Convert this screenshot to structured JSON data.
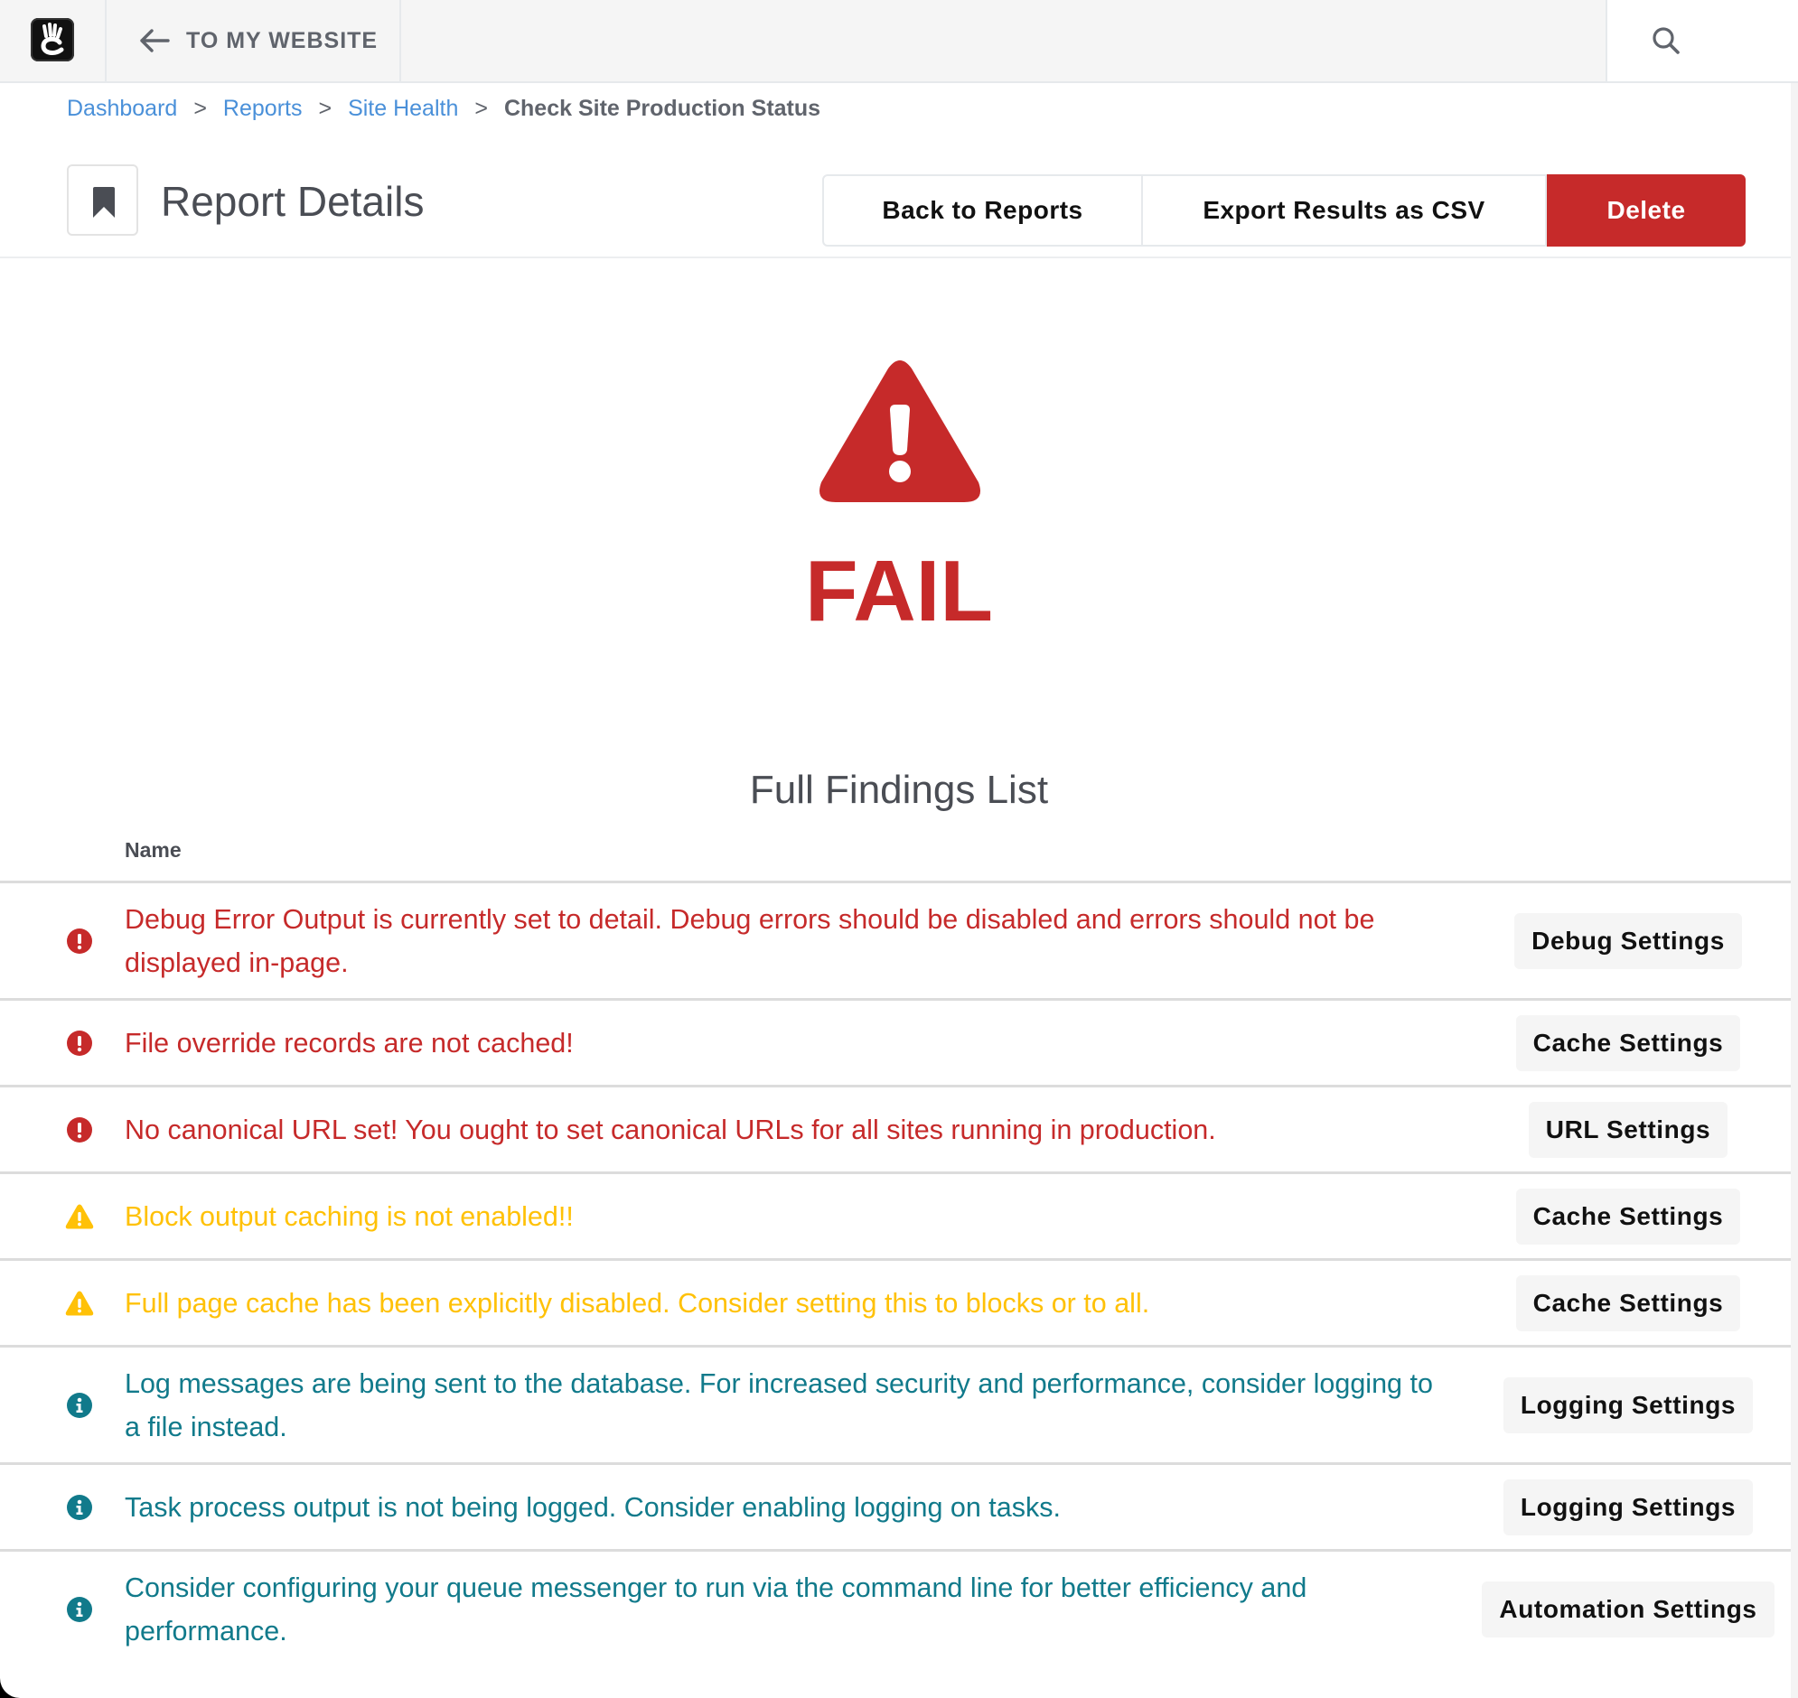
{
  "topbar": {
    "logo_icon": "concrete-hand-logo",
    "back_icon": "arrow-left-icon",
    "back_label": "TO MY WEBSITE",
    "search_icon": "search-icon"
  },
  "breadcrumb": [
    {
      "label": "Dashboard"
    },
    {
      "label": "Reports"
    },
    {
      "label": "Site Health"
    },
    {
      "label": "Check Site Production Status"
    }
  ],
  "breadcrumb_separator": ">",
  "header": {
    "title_icon": "bookmark-icon",
    "title": "Report Details",
    "buttons": {
      "back": "Back to Reports",
      "export": "Export Results as CSV",
      "delete": "Delete"
    }
  },
  "status": {
    "icon": "warning-triangle-icon",
    "label": "FAIL",
    "color": "#c62a2a"
  },
  "findings": {
    "title": "Full Findings List",
    "column_header": "Name",
    "colors": {
      "error": "#c62a2a",
      "warning": "#ffc107",
      "info": "#117a8b"
    },
    "items": [
      {
        "severity": "error",
        "icon": "exclamation-circle-icon",
        "message": "Debug Error Output is currently set to detail. Debug errors should be disabled and errors should not be displayed in-page.",
        "action": "Debug Settings"
      },
      {
        "severity": "error",
        "icon": "exclamation-circle-icon",
        "message": "File override records are not cached!",
        "action": "Cache Settings"
      },
      {
        "severity": "error",
        "icon": "exclamation-circle-icon",
        "message": "No canonical URL set! You ought to set canonical URLs for all sites running in production.",
        "action": "URL Settings"
      },
      {
        "severity": "warning",
        "icon": "warning-triangle-icon",
        "message": "Block output caching is not enabled!!",
        "action": "Cache Settings"
      },
      {
        "severity": "warning",
        "icon": "warning-triangle-icon",
        "message": "Full page cache has been explicitly disabled. Consider setting this to blocks or to all.",
        "action": "Cache Settings"
      },
      {
        "severity": "info",
        "icon": "info-circle-icon",
        "message": "Log messages are being sent to the database. For increased security and performance, consider logging to a file instead.",
        "action": "Logging Settings"
      },
      {
        "severity": "info",
        "icon": "info-circle-icon",
        "message": "Task process output is not being logged. Consider enabling logging on tasks.",
        "action": "Logging Settings"
      },
      {
        "severity": "info",
        "icon": "info-circle-icon",
        "message": "Consider configuring your queue messenger to run via the command line for better efficiency and performance.",
        "action": "Automation Settings"
      }
    ]
  }
}
